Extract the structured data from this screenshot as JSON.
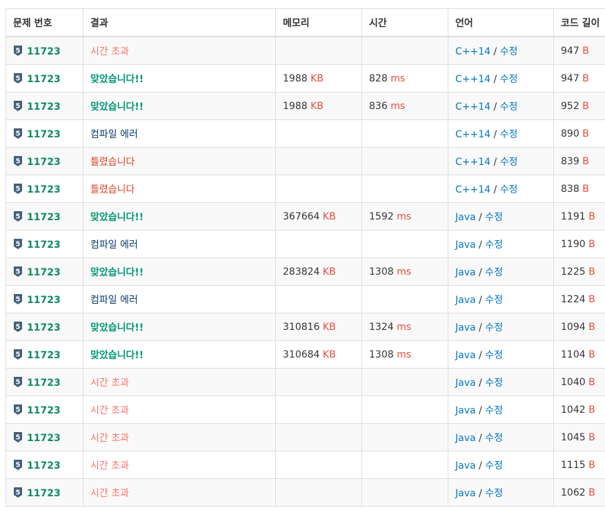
{
  "colors": {
    "accepted": "#009874",
    "wrong": "#dd4124",
    "time_limit": "#fa7268",
    "compile_error": "#0b3a6d",
    "problem_link": "#0f8c5f",
    "unit": "#e74c3c",
    "link": "#0076c0"
  },
  "table": {
    "headers": [
      "문제 번호",
      "결과",
      "메모리",
      "시간",
      "언어",
      "코드 길이"
    ],
    "tier_icon": "level-5-shield-icon",
    "tier_label": "5",
    "separator": "/",
    "edit_label": "수정",
    "mem_unit": "KB",
    "time_unit": "ms",
    "len_unit": "B",
    "rows": [
      {
        "problem": "11723",
        "result": "시간 초과",
        "status": "tle",
        "memory": "",
        "time": "",
        "lang": "C++14",
        "length": "947"
      },
      {
        "problem": "11723",
        "result": "맞았습니다!!",
        "status": "ok",
        "memory": "1988",
        "time": "828",
        "lang": "C++14",
        "length": "947"
      },
      {
        "problem": "11723",
        "result": "맞았습니다!!",
        "status": "ok",
        "memory": "1988",
        "time": "836",
        "lang": "C++14",
        "length": "952"
      },
      {
        "problem": "11723",
        "result": "컴파일 에러",
        "status": "ce",
        "memory": "",
        "time": "",
        "lang": "C++14",
        "length": "890"
      },
      {
        "problem": "11723",
        "result": "틀렸습니다",
        "status": "wrong",
        "memory": "",
        "time": "",
        "lang": "C++14",
        "length": "839"
      },
      {
        "problem": "11723",
        "result": "틀렸습니다",
        "status": "wrong",
        "memory": "",
        "time": "",
        "lang": "C++14",
        "length": "838"
      },
      {
        "problem": "11723",
        "result": "맞았습니다!!",
        "status": "ok",
        "memory": "367664",
        "time": "1592",
        "lang": "Java",
        "length": "1191"
      },
      {
        "problem": "11723",
        "result": "컴파일 에러",
        "status": "ce",
        "memory": "",
        "time": "",
        "lang": "Java",
        "length": "1190"
      },
      {
        "problem": "11723",
        "result": "맞았습니다!!",
        "status": "ok",
        "memory": "283824",
        "time": "1308",
        "lang": "Java",
        "length": "1225"
      },
      {
        "problem": "11723",
        "result": "컴파일 에러",
        "status": "ce",
        "memory": "",
        "time": "",
        "lang": "Java",
        "length": "1224"
      },
      {
        "problem": "11723",
        "result": "맞았습니다!!",
        "status": "ok",
        "memory": "310816",
        "time": "1324",
        "lang": "Java",
        "length": "1094"
      },
      {
        "problem": "11723",
        "result": "맞았습니다!!",
        "status": "ok",
        "memory": "310684",
        "time": "1308",
        "lang": "Java",
        "length": "1104"
      },
      {
        "problem": "11723",
        "result": "시간 초과",
        "status": "tle",
        "memory": "",
        "time": "",
        "lang": "Java",
        "length": "1040"
      },
      {
        "problem": "11723",
        "result": "시간 초과",
        "status": "tle",
        "memory": "",
        "time": "",
        "lang": "Java",
        "length": "1042"
      },
      {
        "problem": "11723",
        "result": "시간 초과",
        "status": "tle",
        "memory": "",
        "time": "",
        "lang": "Java",
        "length": "1045"
      },
      {
        "problem": "11723",
        "result": "시간 초과",
        "status": "tle",
        "memory": "",
        "time": "",
        "lang": "Java",
        "length": "1115"
      },
      {
        "problem": "11723",
        "result": "시간 초과",
        "status": "tle",
        "memory": "",
        "time": "",
        "lang": "Java",
        "length": "1062"
      }
    ]
  }
}
